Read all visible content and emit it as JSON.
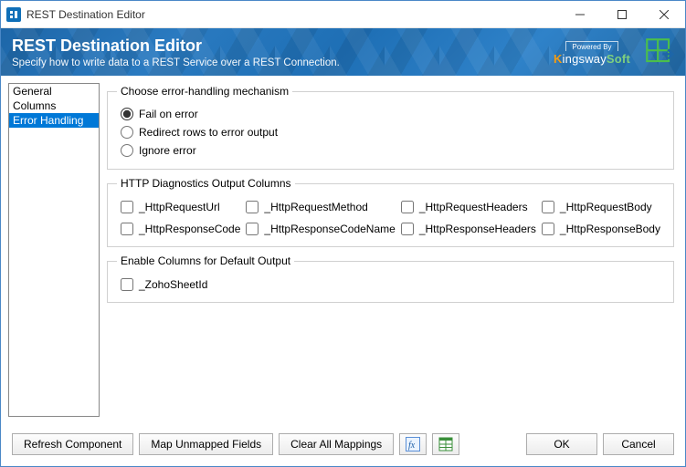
{
  "window": {
    "title": "REST Destination Editor"
  },
  "banner": {
    "title": "REST Destination Editor",
    "subtitle": "Specify how to write data to a REST Service over a REST Connection.",
    "logo_small": "Powered By",
    "logo_main_k": "K",
    "logo_main_mid": "ingsway",
    "logo_main_soft": "Soft"
  },
  "sidebar": {
    "items": [
      {
        "label": "General"
      },
      {
        "label": "Columns"
      },
      {
        "label": "Error Handling"
      }
    ]
  },
  "error_handling": {
    "group_label": "Choose error-handling mechanism",
    "options": {
      "fail": "Fail on error",
      "redirect": "Redirect rows to error output",
      "ignore": "Ignore error"
    }
  },
  "diagnostics": {
    "group_label": "HTTP Diagnostics Output Columns",
    "columns": {
      "request_url": "_HttpRequestUrl",
      "request_method": "_HttpRequestMethod",
      "request_headers": "_HttpRequestHeaders",
      "request_body": "_HttpRequestBody",
      "response_code": "_HttpResponseCode",
      "response_code_name": "_HttpResponseCodeName",
      "response_headers": "_HttpResponseHeaders",
      "response_body": "_HttpResponseBody"
    }
  },
  "default_output": {
    "group_label": "Enable Columns for Default Output",
    "columns": {
      "zoho_sheet_id": "_ZohoSheetId"
    }
  },
  "footer": {
    "refresh": "Refresh Component",
    "map_unmapped": "Map Unmapped Fields",
    "clear_mappings": "Clear All Mappings",
    "ok": "OK",
    "cancel": "Cancel"
  }
}
